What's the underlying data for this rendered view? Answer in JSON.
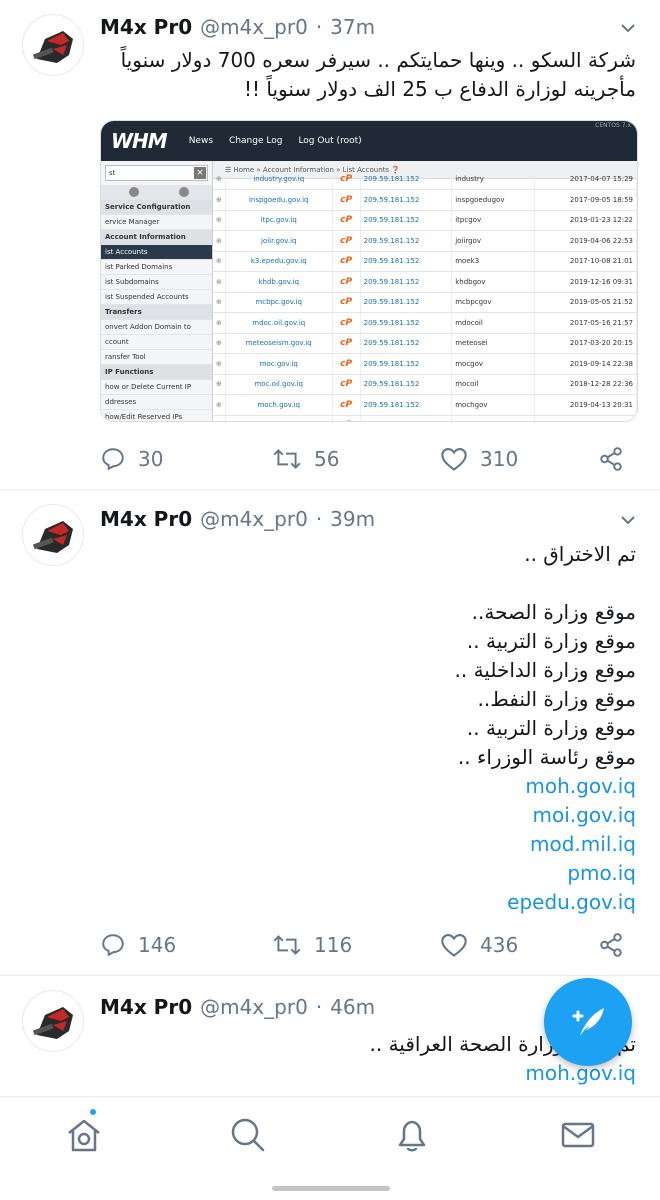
{
  "tweets": [
    {
      "name": "M4x Pr0",
      "handle": "@m4x_pr0",
      "dot": "·",
      "time": "37m",
      "text": [
        "شركة السكو .. وينها حمايتكم .. سيرفر سعره 700 دولار سنوياً",
        "مأجرينه لوزارة الدفاع ب 25 الف دولار سنوياً !!"
      ],
      "replies": "30",
      "retweets": "56",
      "likes": "310"
    },
    {
      "name": "M4x Pr0",
      "handle": "@m4x_pr0",
      "dot": "·",
      "time": "39m",
      "text": [
        "تم الاختراق ..",
        "",
        "موقع وزارة الصحة..",
        "موقع وزارة التربية ..",
        "موقع وزارة الداخلية ..",
        "موقع وزارة النفط..",
        "موقع وزارة التربية ..",
        "موقع رئاسة الوزراء .."
      ],
      "links": [
        "moh.gov.iq",
        "moi.gov.iq",
        "mod.mil.iq",
        "pmo.iq",
        "epedu.gov.iq"
      ],
      "replies": "146",
      "retweets": "116",
      "likes": "436"
    },
    {
      "name": "M4x Pr0",
      "handle": "@m4x_pr0",
      "dot": "·",
      "time": "46m",
      "text": [
        "تم موقع وزارة الصحة العراقية .."
      ],
      "links": [
        "moh.gov.iq"
      ]
    }
  ],
  "whm": {
    "logo": "WHM",
    "nav": [
      "News",
      "Change Log",
      "Log Out (root)"
    ],
    "corner": "CENTOS 7.x",
    "search": "st",
    "breadcrumb": "Home » Account Information » List Accounts",
    "sidebar": [
      {
        "label": "Service Configuration",
        "kind": "sec"
      },
      {
        "label": "ervice Manager",
        "kind": ""
      },
      {
        "label": "Account Information",
        "kind": "sec"
      },
      {
        "label": "ist Accounts",
        "kind": "active"
      },
      {
        "label": "ist Parked Domains",
        "kind": ""
      },
      {
        "label": "ist Subdomains",
        "kind": ""
      },
      {
        "label": "ist Suspended Accounts",
        "kind": ""
      },
      {
        "label": "Transfers",
        "kind": "sec"
      },
      {
        "label": "onvert Addon Domain to",
        "kind": ""
      },
      {
        "label": "ccount",
        "kind": ""
      },
      {
        "label": "ransfer Tool",
        "kind": ""
      },
      {
        "label": "IP Functions",
        "kind": "sec"
      },
      {
        "label": "how or Delete Current IP",
        "kind": ""
      },
      {
        "label": "ddresses",
        "kind": ""
      },
      {
        "label": "how/Edit Reserved IPs",
        "kind": ""
      }
    ],
    "cp_label": "cP",
    "rows": [
      {
        "domain": "industry.gov.iq",
        "ip": "209.59.181.152",
        "user": "industry",
        "date": "2017-04-07 15:29"
      },
      {
        "domain": "inspgoedu.gov.iq",
        "ip": "209.59.181.152",
        "user": "inspgoedugov",
        "date": "2017-09-05 18:59"
      },
      {
        "domain": "itpc.gov.iq",
        "ip": "209.59.181.152",
        "user": "itpcgov",
        "date": "2019-01-23 12:22"
      },
      {
        "domain": "joiir.gov.iq",
        "ip": "209.59.181.152",
        "user": "joiirgov",
        "date": "2019-04-06 22:53"
      },
      {
        "domain": "k3.epedu.gov.iq",
        "ip": "209.59.181.152",
        "user": "moek3",
        "date": "2017-10-08 21:01"
      },
      {
        "domain": "khdb.gov.iq",
        "ip": "209.59.181.152",
        "user": "khdbgov",
        "date": "2019-12-16 09:31"
      },
      {
        "domain": "mcbpc.gov.iq",
        "ip": "209.59.181.152",
        "user": "mcbpcgov",
        "date": "2019-05-05 21:52"
      },
      {
        "domain": "mdoc.oil.gov.iq",
        "ip": "209.59.181.152",
        "user": "mdocoil",
        "date": "2017-05-16 21:57"
      },
      {
        "domain": "meteoseism.gov.iq",
        "ip": "209.59.181.152",
        "user": "meteosei",
        "date": "2017-03-20 20:15"
      },
      {
        "domain": "moc.gov.iq",
        "ip": "209.59.181.152",
        "user": "mocgov",
        "date": "2019-09-14 22:38"
      },
      {
        "domain": "moc.oil.gov.iq",
        "ip": "209.59.181.152",
        "user": "mocoil",
        "date": "2018-12-28 22:36"
      },
      {
        "domain": "moch.gov.iq",
        "ip": "209.59.181.152",
        "user": "mochgov",
        "date": "2019-04-13 20:31"
      },
      {
        "domain": "mocom.gov.iq",
        "ip": "209.59.181.152",
        "user": "mocomgov",
        "date": "2017-12-28 22:37"
      }
    ]
  },
  "icons": {
    "reply": "reply-icon",
    "retweet": "retweet-icon",
    "like": "heart-icon",
    "share": "share-icon",
    "compose": "compose-icon",
    "home": "home-icon",
    "search": "search-icon",
    "notifications": "bell-icon",
    "messages": "mail-icon"
  },
  "colors": {
    "accent": "#1da1f2",
    "link": "#1b95e0",
    "muted": "#657786"
  }
}
